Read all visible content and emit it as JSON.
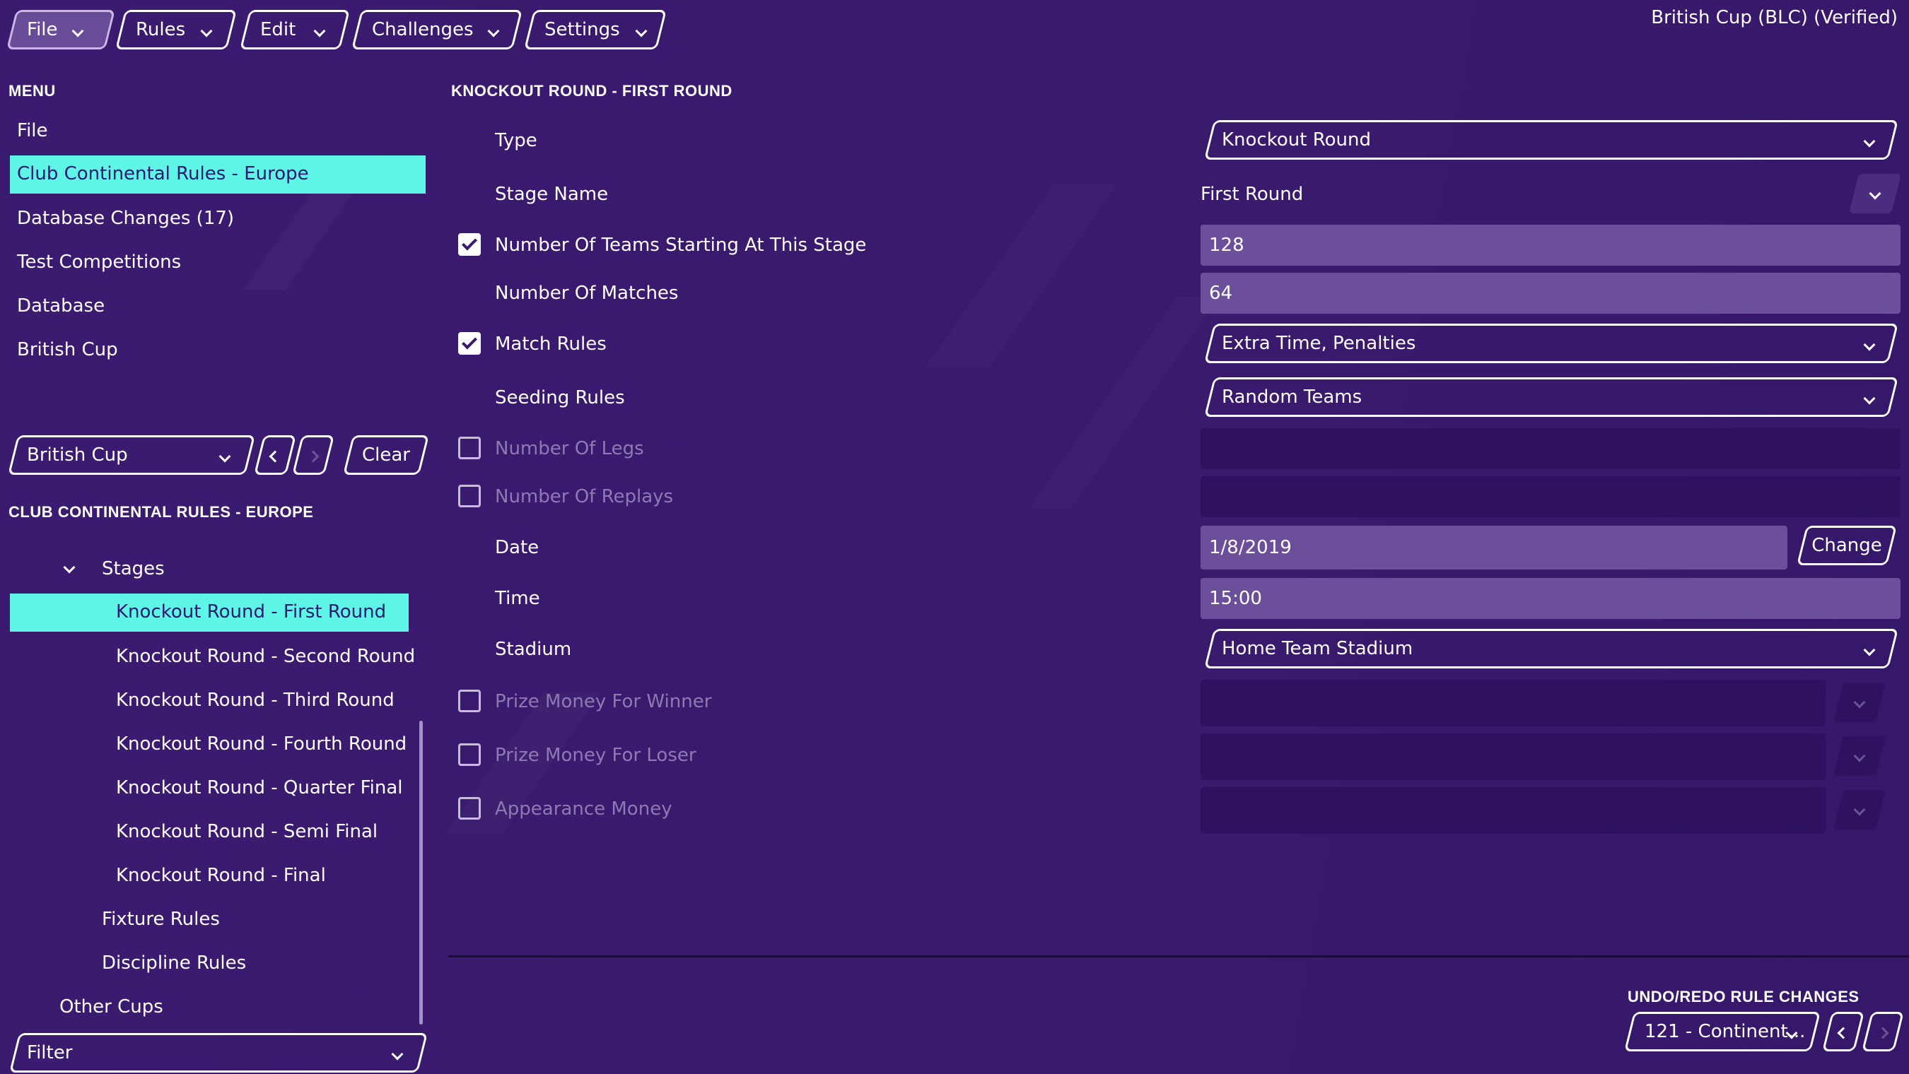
{
  "toolbar": {
    "file": "File",
    "rules": "Rules",
    "edit": "Edit",
    "challenges": "Challenges",
    "settings": "Settings"
  },
  "window_title": "British Cup (BLC) (Verified)",
  "menu": {
    "heading": "MENU",
    "items": [
      "File",
      "Club Continental Rules - Europe",
      "Database Changes (17)",
      "Test Competitions",
      "Database",
      "British Cup"
    ]
  },
  "selector": {
    "value": "British Cup",
    "clear_label": "Clear"
  },
  "tree": {
    "heading": "CLUB CONTINENTAL RULES - EUROPE",
    "stages_label": "Stages",
    "stages": [
      "Knockout Round - First Round",
      "Knockout Round - Second Round",
      "Knockout Round - Third Round",
      "Knockout Round - Fourth Round",
      "Knockout Round - Quarter Final",
      "Knockout Round - Semi Final",
      "Knockout Round - Final"
    ],
    "fixture_rules": "Fixture Rules",
    "discipline_rules": "Discipline Rules",
    "other_cups": "Other Cups"
  },
  "filter": {
    "label": "Filter"
  },
  "detail": {
    "heading": "KNOCKOUT ROUND - FIRST ROUND",
    "type": {
      "label": "Type",
      "value": "Knockout Round"
    },
    "stage_name": {
      "label": "Stage Name",
      "value": "First Round"
    },
    "teams_starting": {
      "label": "Number Of Teams Starting At This Stage",
      "value": "128",
      "checked": true
    },
    "matches": {
      "label": "Number Of Matches",
      "value": "64"
    },
    "match_rules": {
      "label": "Match Rules",
      "value": "Extra Time, Penalties",
      "checked": true
    },
    "seeding_rules": {
      "label": "Seeding Rules",
      "value": "Random Teams"
    },
    "legs": {
      "label": "Number Of Legs",
      "checked": false
    },
    "replays": {
      "label": "Number Of Replays",
      "checked": false
    },
    "date": {
      "label": "Date",
      "value": "1/8/2019",
      "change_label": "Change"
    },
    "time": {
      "label": "Time",
      "value": "15:00"
    },
    "stadium": {
      "label": "Stadium",
      "value": "Home Team Stadium"
    },
    "prize_winner": {
      "label": "Prize Money For Winner",
      "checked": false
    },
    "prize_loser": {
      "label": "Prize Money For Loser",
      "checked": false
    },
    "appearance": {
      "label": "Appearance Money",
      "checked": false
    }
  },
  "undo": {
    "heading": "UNDO/REDO RULE CHANGES",
    "value": "121 - Continent..."
  },
  "colors": {
    "background": "#3a1a6e",
    "accent": "#5ff5e6",
    "field": "#6b4f9a",
    "field_dark": "#2e1260"
  }
}
